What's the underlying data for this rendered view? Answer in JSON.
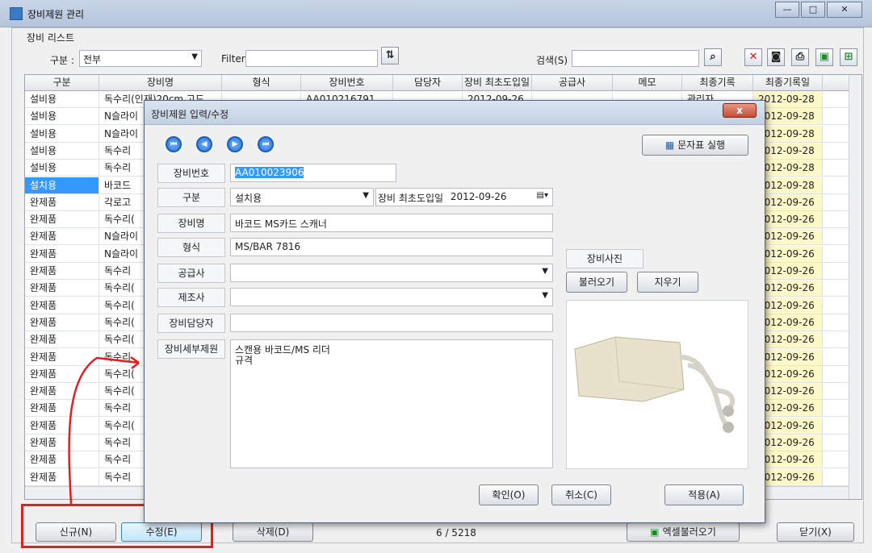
{
  "window": {
    "title": "장비제원 관리",
    "min": "—",
    "max": "□",
    "close": "✕"
  },
  "group_label": "장비 리스트",
  "filterbar": {
    "category_label": "구분 :",
    "category_value": "전부",
    "filter_label": "Filter",
    "filter_value": "",
    "search_label": "검색(S)",
    "search_value": ""
  },
  "grid": {
    "headers": [
      "구분",
      "장비명",
      "형식",
      "장비번호",
      "담당자",
      "장비 최초도입일",
      "공급사",
      "메모",
      "최종기록",
      "최종기록일"
    ],
    "rows": [
      [
        "설비용",
        "독수리(인재)20cm 고드",
        "",
        "AA010216791",
        "",
        "2012-09-26",
        "",
        "",
        "관리자",
        "2012-09-28"
      ],
      [
        "설비용",
        "N슬라이",
        "",
        "",
        "",
        "",
        "",
        "",
        "",
        "2012-09-28"
      ],
      [
        "설비용",
        "N슬라이",
        "",
        "",
        "",
        "",
        "",
        "",
        "",
        "2012-09-28"
      ],
      [
        "설비용",
        "독수리",
        "",
        "",
        "",
        "",
        "",
        "",
        "",
        "2012-09-28"
      ],
      [
        "설비용",
        "독수리",
        "",
        "",
        "",
        "",
        "",
        "",
        "",
        "2012-09-28"
      ],
      [
        "설치용",
        "바코드",
        "",
        "",
        "",
        "",
        "",
        "",
        "",
        "2012-09-28"
      ],
      [
        "완제품",
        "각로고",
        "",
        "",
        "",
        "",
        "",
        "",
        "",
        "2012-09-26"
      ],
      [
        "완제품",
        "독수리(",
        "",
        "",
        "",
        "",
        "",
        "",
        "",
        "2012-09-26"
      ],
      [
        "완제품",
        "N슬라이",
        "",
        "",
        "",
        "",
        "",
        "",
        "",
        "2012-09-26"
      ],
      [
        "완제품",
        "N슬라이",
        "",
        "",
        "",
        "",
        "",
        "",
        "",
        "2012-09-26"
      ],
      [
        "완제품",
        "독수리",
        "",
        "",
        "",
        "",
        "",
        "",
        "",
        "2012-09-26"
      ],
      [
        "완제품",
        "독수리(",
        "",
        "",
        "",
        "",
        "",
        "",
        "",
        "2012-09-26"
      ],
      [
        "완제품",
        "독수리(",
        "",
        "",
        "",
        "",
        "",
        "",
        "",
        "2012-09-26"
      ],
      [
        "완제품",
        "독수리(",
        "",
        "",
        "",
        "",
        "",
        "",
        "",
        "2012-09-26"
      ],
      [
        "완제품",
        "독수리(",
        "",
        "",
        "",
        "",
        "",
        "",
        "",
        "2012-09-26"
      ],
      [
        "완제품",
        "독수리",
        "",
        "",
        "",
        "",
        "",
        "",
        "",
        "2012-09-26"
      ],
      [
        "완제품",
        "독수리(",
        "",
        "",
        "",
        "",
        "",
        "",
        "",
        "2012-09-26"
      ],
      [
        "완제품",
        "독수리(",
        "",
        "",
        "",
        "",
        "",
        "",
        "",
        "2012-09-26"
      ],
      [
        "완제품",
        "독수리",
        "",
        "",
        "",
        "",
        "",
        "",
        "",
        "2012-09-26"
      ],
      [
        "완제품",
        "독수리(",
        "",
        "",
        "",
        "",
        "",
        "",
        "",
        "2012-09-26"
      ],
      [
        "완제품",
        "독수리",
        "",
        "",
        "",
        "",
        "",
        "",
        "",
        "2012-09-26"
      ],
      [
        "완제품",
        "독수리",
        "",
        "",
        "",
        "",
        "",
        "",
        "",
        "2012-09-26"
      ],
      [
        "완제품",
        "독수리",
        "",
        "",
        "",
        "",
        "",
        "",
        "",
        "2012-09-26"
      ]
    ]
  },
  "bottom": {
    "new": "신규(N)",
    "edit": "수정(E)",
    "delete": "삭제(D)",
    "page": "6 / 5218",
    "excel": "엑셀불러오기",
    "close": "닫기(X)"
  },
  "dialog": {
    "title": "장비제원 입력/수정",
    "close": "x",
    "run_label": "문자표 실행",
    "fields": {
      "no_label": "장비번호",
      "no_value": "AA010023906",
      "cat_label": "구분",
      "cat_value": "설치용",
      "date_label": "장비 최초도입일",
      "date_value": "2012-09-26",
      "name_label": "장비명",
      "name_value": "바코드 MS카드 스캐너",
      "model_label": "형식",
      "model_value": "MS/BAR 7816",
      "supplier_label": "공급사",
      "supplier_value": "",
      "maker_label": "제조사",
      "maker_value": "",
      "manager_label": "장비담당자",
      "manager_value": "",
      "detail_label": "장비세부제원",
      "detail_line1": "스캔용 바코드/MS 리더",
      "detail_line2": "규격"
    },
    "photo_label": "장비사진",
    "load": "불러오기",
    "erase": "지우기",
    "ok": "확인(O)",
    "cancel": "취소(C)",
    "apply": "적용(A)"
  }
}
